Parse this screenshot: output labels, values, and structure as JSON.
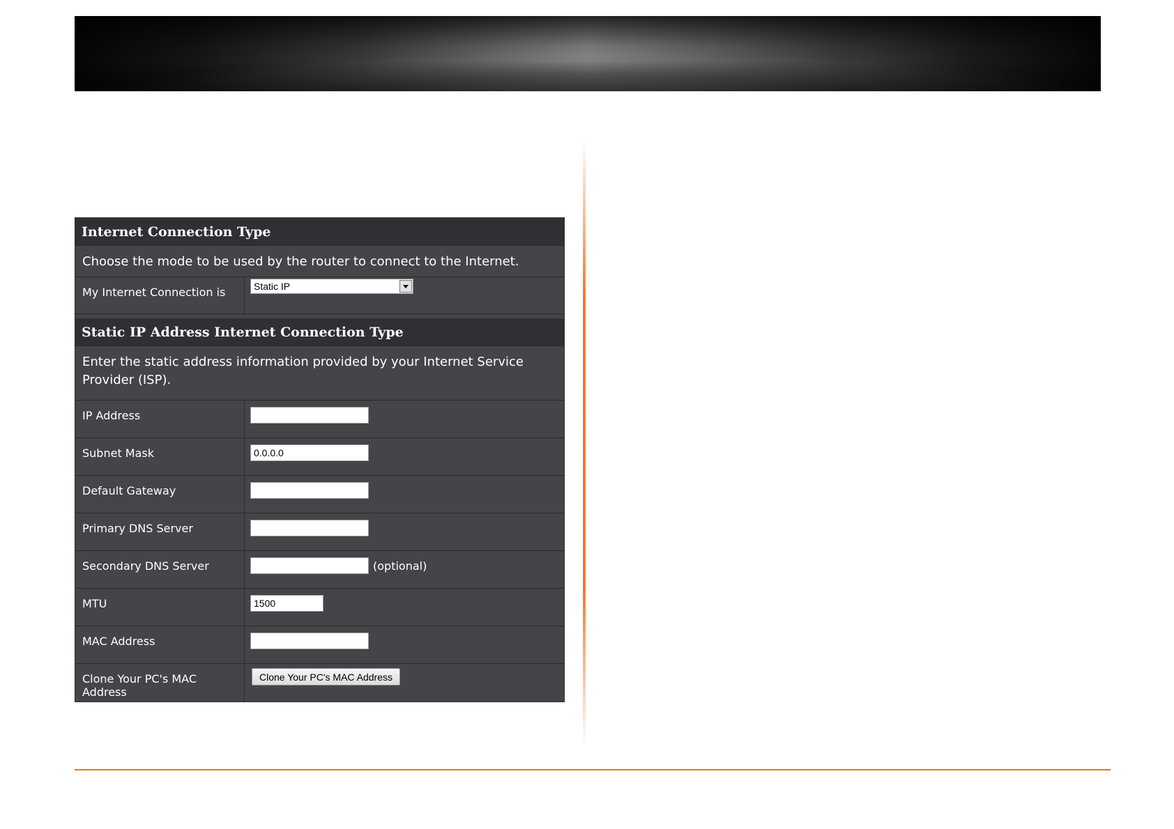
{
  "connection_type": {
    "title": "Internet Connection Type",
    "description": "Choose the mode to be used by the router to connect to the Internet.",
    "mode_label": "My Internet Connection is",
    "mode_value": "Static IP"
  },
  "static_ip": {
    "title": "Static IP Address Internet Connection Type",
    "description": "Enter the static address information provided by your Internet Service Provider (ISP).",
    "fields": [
      {
        "label": "IP Address",
        "value": ""
      },
      {
        "label": "Subnet Mask",
        "value": "0.0.0.0"
      },
      {
        "label": "Default Gateway",
        "value": ""
      },
      {
        "label": "Primary DNS Server",
        "value": ""
      },
      {
        "label": "Secondary DNS Server",
        "value": "",
        "hint": "(optional)"
      },
      {
        "label": "MTU",
        "value": "1500"
      },
      {
        "label": "MAC Address",
        "value": ""
      }
    ],
    "clone_label": "Clone Your PC's MAC Address",
    "clone_button": "Clone Your PC's MAC Address"
  },
  "colors": {
    "panel_bg": "#444549",
    "header_bg": "#2f3033",
    "accent_orange": "#e07b17"
  }
}
